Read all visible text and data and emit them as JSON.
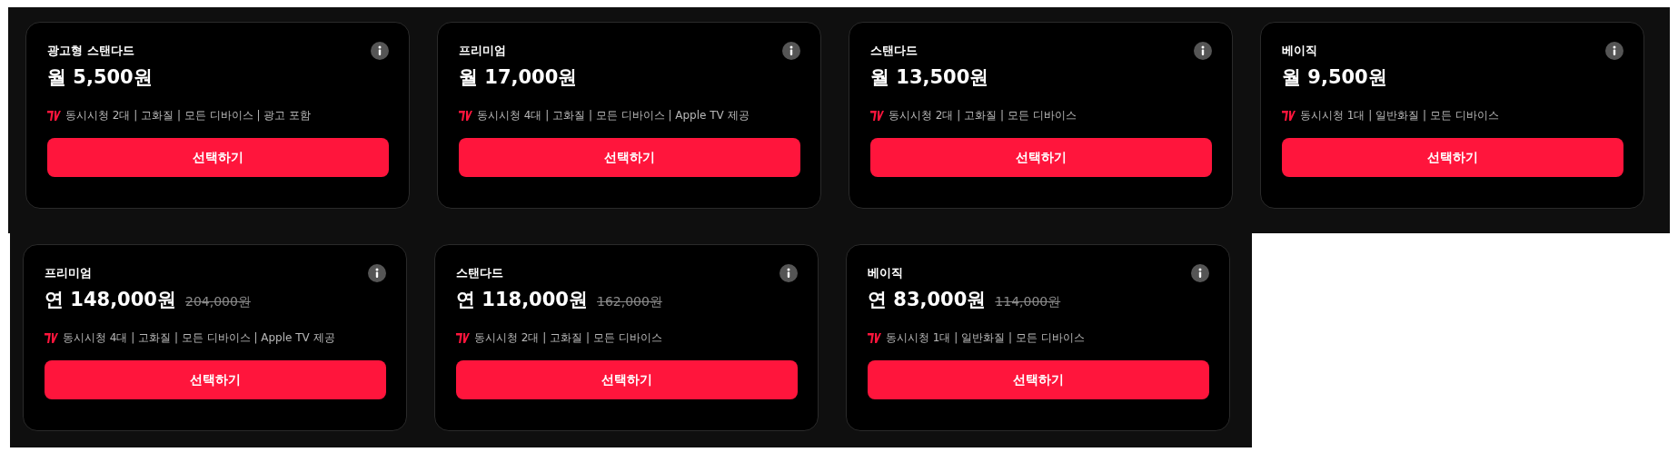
{
  "plan_groups": [
    {
      "plans": [
        {
          "name": "광고형 스탠다드",
          "price": "월 5,500원",
          "features": "동시시청 2대 | 고화질 | 모든 디바이스 | 광고 포함",
          "button": "선택하기"
        },
        {
          "name": "프리미엄",
          "price": "월 17,000원",
          "features": "동시시청 4대 | 고화질 | 모든 디바이스 | Apple TV 제공",
          "button": "선택하기"
        },
        {
          "name": "스탠다드",
          "price": "월 13,500원",
          "features": "동시시청 2대 | 고화질 | 모든 디바이스",
          "button": "선택하기"
        },
        {
          "name": "베이직",
          "price": "월 9,500원",
          "features": "동시시청 1대 | 일반화질 | 모든 디바이스",
          "button": "선택하기"
        }
      ]
    },
    {
      "plans": [
        {
          "name": "프리미엄",
          "price": "연 148,000원",
          "original_price": "204,000원",
          "features": "동시시청 4대 | 고화질 | 모든 디바이스 | Apple TV 제공",
          "button": "선택하기"
        },
        {
          "name": "스탠다드",
          "price": "연 118,000원",
          "original_price": "162,000원",
          "features": "동시시청 2대 | 고화질 | 모든 디바이스",
          "button": "선택하기"
        },
        {
          "name": "베이직",
          "price": "연 83,000원",
          "original_price": "114,000원",
          "features": "동시시청 1대 | 일반화질 | 모든 디바이스",
          "button": "선택하기"
        }
      ]
    }
  ]
}
